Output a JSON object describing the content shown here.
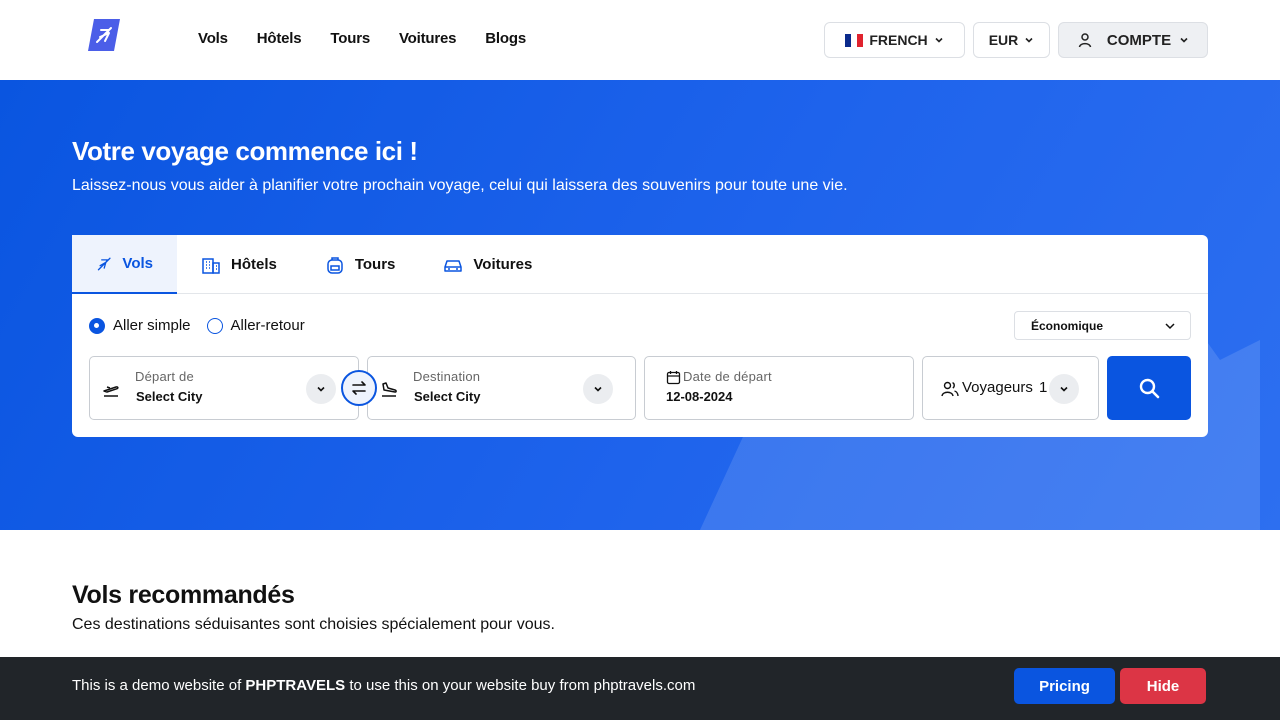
{
  "header": {
    "logo_icon": "plane-logo-icon",
    "nav": [
      {
        "label": "Vols"
      },
      {
        "label": "Hôtels"
      },
      {
        "label": "Tours"
      },
      {
        "label": "Voitures"
      },
      {
        "label": "Blogs"
      }
    ],
    "language": {
      "label": "FRENCH",
      "flag_colors": [
        "#0b2a8c",
        "#ffffff",
        "#e0232e"
      ]
    },
    "currency": {
      "label": "EUR"
    },
    "account": {
      "label": "COMPTE"
    }
  },
  "hero": {
    "title": "Votre voyage commence ici !",
    "subtitle": "Laissez-nous vous aider à planifier votre prochain voyage, celui qui laissera des souvenirs pour toute une vie."
  },
  "search": {
    "tabs": [
      {
        "label": "Vols",
        "icon": "plane-icon",
        "active": true
      },
      {
        "label": "Hôtels",
        "icon": "building-icon",
        "active": false
      },
      {
        "label": "Tours",
        "icon": "backpack-icon",
        "active": false
      },
      {
        "label": "Voitures",
        "icon": "car-icon",
        "active": false
      }
    ],
    "trip_types": [
      {
        "label": "Aller simple",
        "selected": true
      },
      {
        "label": "Aller-retour",
        "selected": false
      }
    ],
    "cabin_class": "Économique",
    "from": {
      "label": "Départ de",
      "value": "Select City"
    },
    "to": {
      "label": "Destination",
      "value": "Select City"
    },
    "date": {
      "label": "Date de départ",
      "value": "12-08-2024"
    },
    "travellers": {
      "label": "Voyageurs",
      "count": "1"
    }
  },
  "recommended": {
    "title": "Vols recommandés",
    "subtitle": "Ces destinations séduisantes sont choisies spécialement pour vous."
  },
  "demo_bar": {
    "text_before": "This is a demo website of ",
    "brand": "PHPTRAVELS",
    "text_after": " to use this on your website buy from phptravels.com",
    "pricing_label": "Pricing",
    "hide_label": "Hide"
  },
  "colors": {
    "primary": "#0a55e0",
    "danger": "#dc3545",
    "dark_bar": "#212529"
  }
}
